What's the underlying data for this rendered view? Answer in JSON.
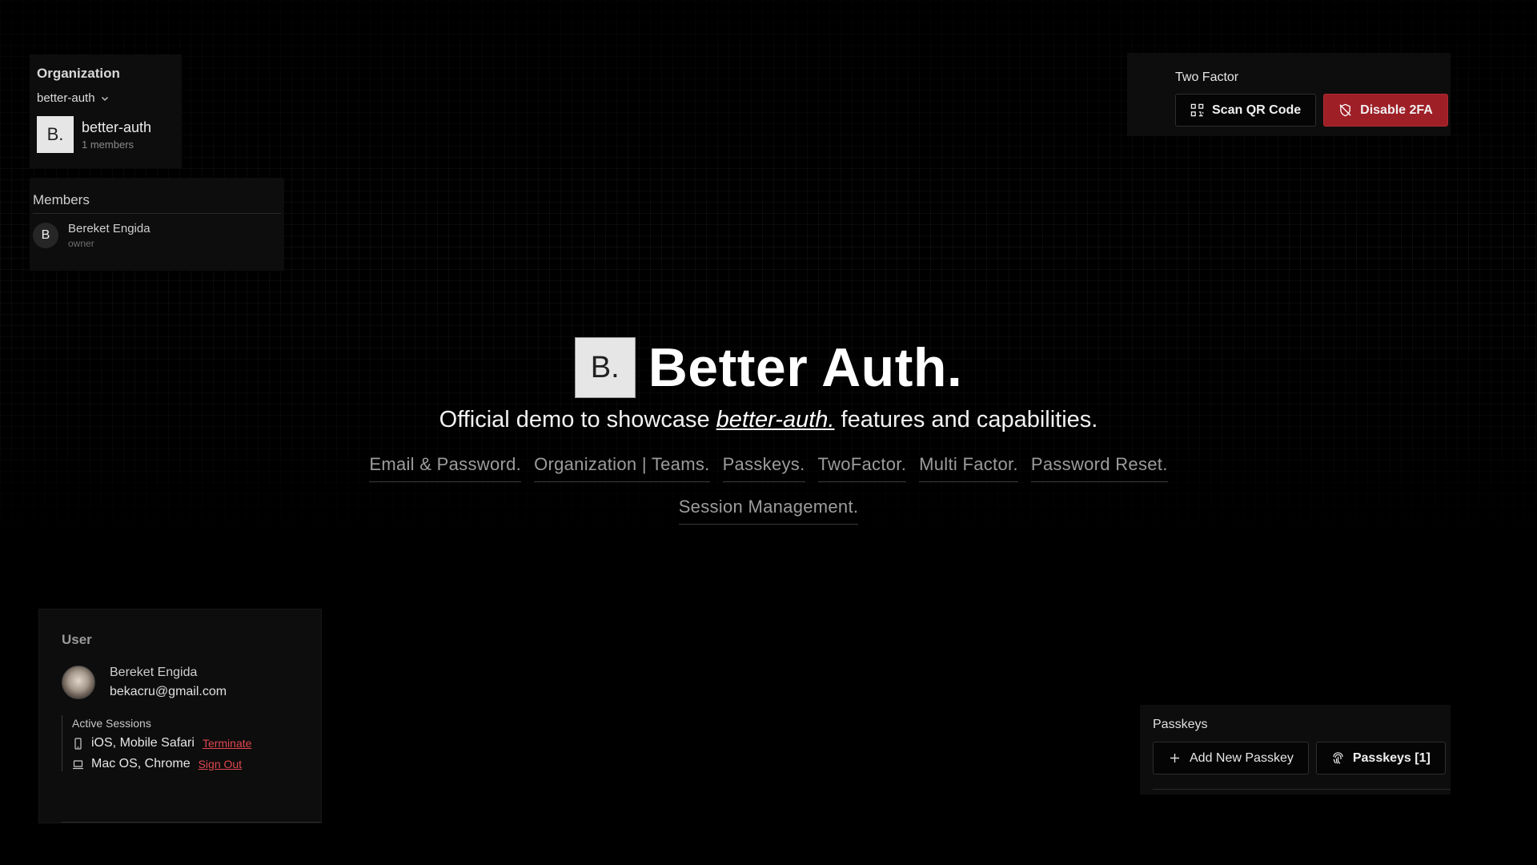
{
  "organization": {
    "title": "Organization",
    "selected": "better-auth",
    "logo_text": "B.",
    "name": "better-auth",
    "member_count": "1 members"
  },
  "members": {
    "title": "Members",
    "list": [
      {
        "initial": "B",
        "name": "Bereket Engida",
        "role": "owner"
      }
    ]
  },
  "two_factor": {
    "title": "Two Factor",
    "scan_label": "Scan QR Code",
    "disable_label": "Disable 2FA"
  },
  "hero": {
    "logo_text": "B.",
    "title": "Better Auth.",
    "sub_before": "Official demo to showcase",
    "sub_link": "better-auth.",
    "sub_after": "features and capabilities.",
    "features": [
      "Email & Password.",
      "Organization | Teams.",
      "Passkeys.",
      "TwoFactor.",
      "Multi Factor.",
      "Password Reset.",
      "Session Management."
    ]
  },
  "user": {
    "title": "User",
    "name": "Bereket Engida",
    "email": "bekacru@gmail.com",
    "sessions_title": "Active Sessions",
    "sessions": [
      {
        "device": "iOS, Mobile Safari",
        "action": "Terminate",
        "icon": "phone-icon"
      },
      {
        "device": "Mac OS, Chrome",
        "action": "Sign Out",
        "icon": "laptop-icon"
      }
    ]
  },
  "passkeys": {
    "title": "Passkeys",
    "add_label": "Add New Passkey",
    "list_label": "Passkeys [1]"
  },
  "colors": {
    "background": "#000000",
    "danger": "#9f1f27",
    "link_red": "#e0474f"
  }
}
